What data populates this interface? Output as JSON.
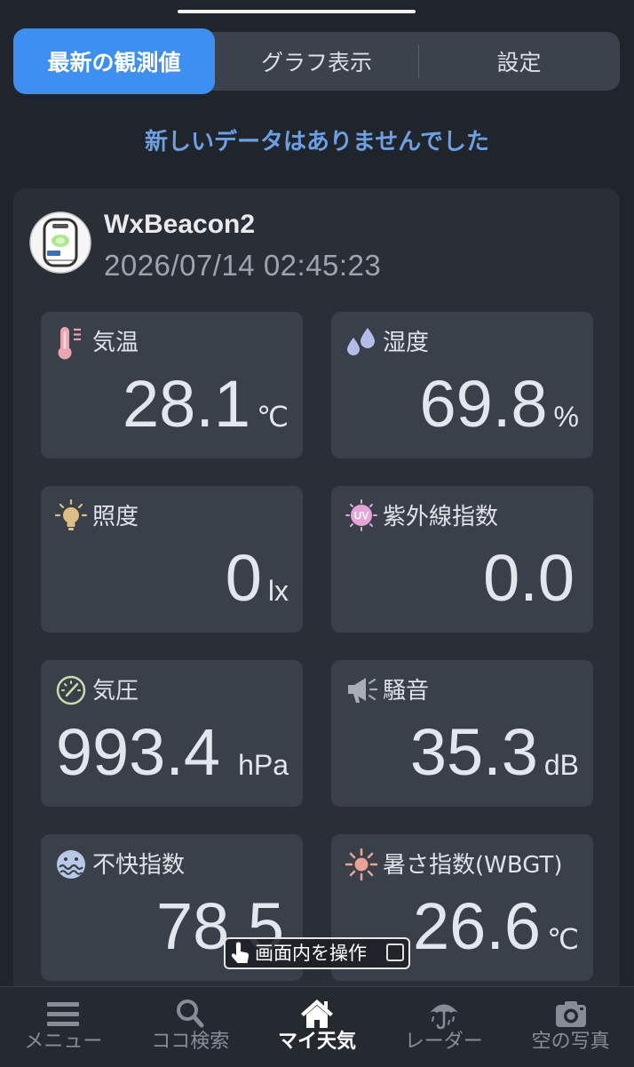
{
  "tabs": {
    "items": [
      {
        "label": "最新の観測値"
      },
      {
        "label": "グラフ表示"
      },
      {
        "label": "設定"
      }
    ],
    "active_index": 0
  },
  "status_message": "新しいデータはありませんでした",
  "device": {
    "name": "WxBeacon2",
    "timestamp": "2026/07/14 02:45:23",
    "icon": "wxbeacon-device-icon"
  },
  "readings": [
    {
      "label": "気温",
      "value": "28.1",
      "unit": "℃",
      "icon": "thermometer-icon"
    },
    {
      "label": "湿度",
      "value": "69.8",
      "unit": "%",
      "icon": "humidity-drops-icon"
    },
    {
      "label": "照度",
      "value": "0",
      "unit": "lx",
      "icon": "light-bulb-icon"
    },
    {
      "label": "紫外線指数",
      "value": "0.0",
      "icon": "uv-icon",
      "icon_text": "UV"
    },
    {
      "label": "気圧",
      "value": "993.4",
      "unit": "hPa",
      "icon": "pressure-gauge-icon"
    },
    {
      "label": "騒音",
      "value": "35.3",
      "unit": "dB",
      "icon": "megaphone-icon"
    },
    {
      "label": "不快指数",
      "value": "78.5",
      "icon": "discomfort-index-icon"
    },
    {
      "label": "暑さ指数(WBGT)",
      "value": "26.6",
      "unit": "℃",
      "icon": "heat-sun-icon"
    }
  ],
  "overlay": {
    "label": "画面内を操作",
    "icon": "pointing-hand-icon",
    "checked": false
  },
  "nav": {
    "items": [
      {
        "label": "メニュー",
        "icon": "hamburger-menu-icon"
      },
      {
        "label": "ココ検索",
        "icon": "search-icon"
      },
      {
        "label": "マイ天気",
        "icon": "home-icon"
      },
      {
        "label": "レーダー",
        "icon": "umbrella-icon"
      },
      {
        "label": "空の写真",
        "icon": "camera-icon"
      }
    ],
    "active_index": 2
  },
  "colors": {
    "background": "#20252c",
    "card": "#2a2f37",
    "tile": "#3a404a",
    "accent": "#3d8ff1",
    "status_message": "#6d9fe2",
    "nav_inactive": "#878d98"
  }
}
